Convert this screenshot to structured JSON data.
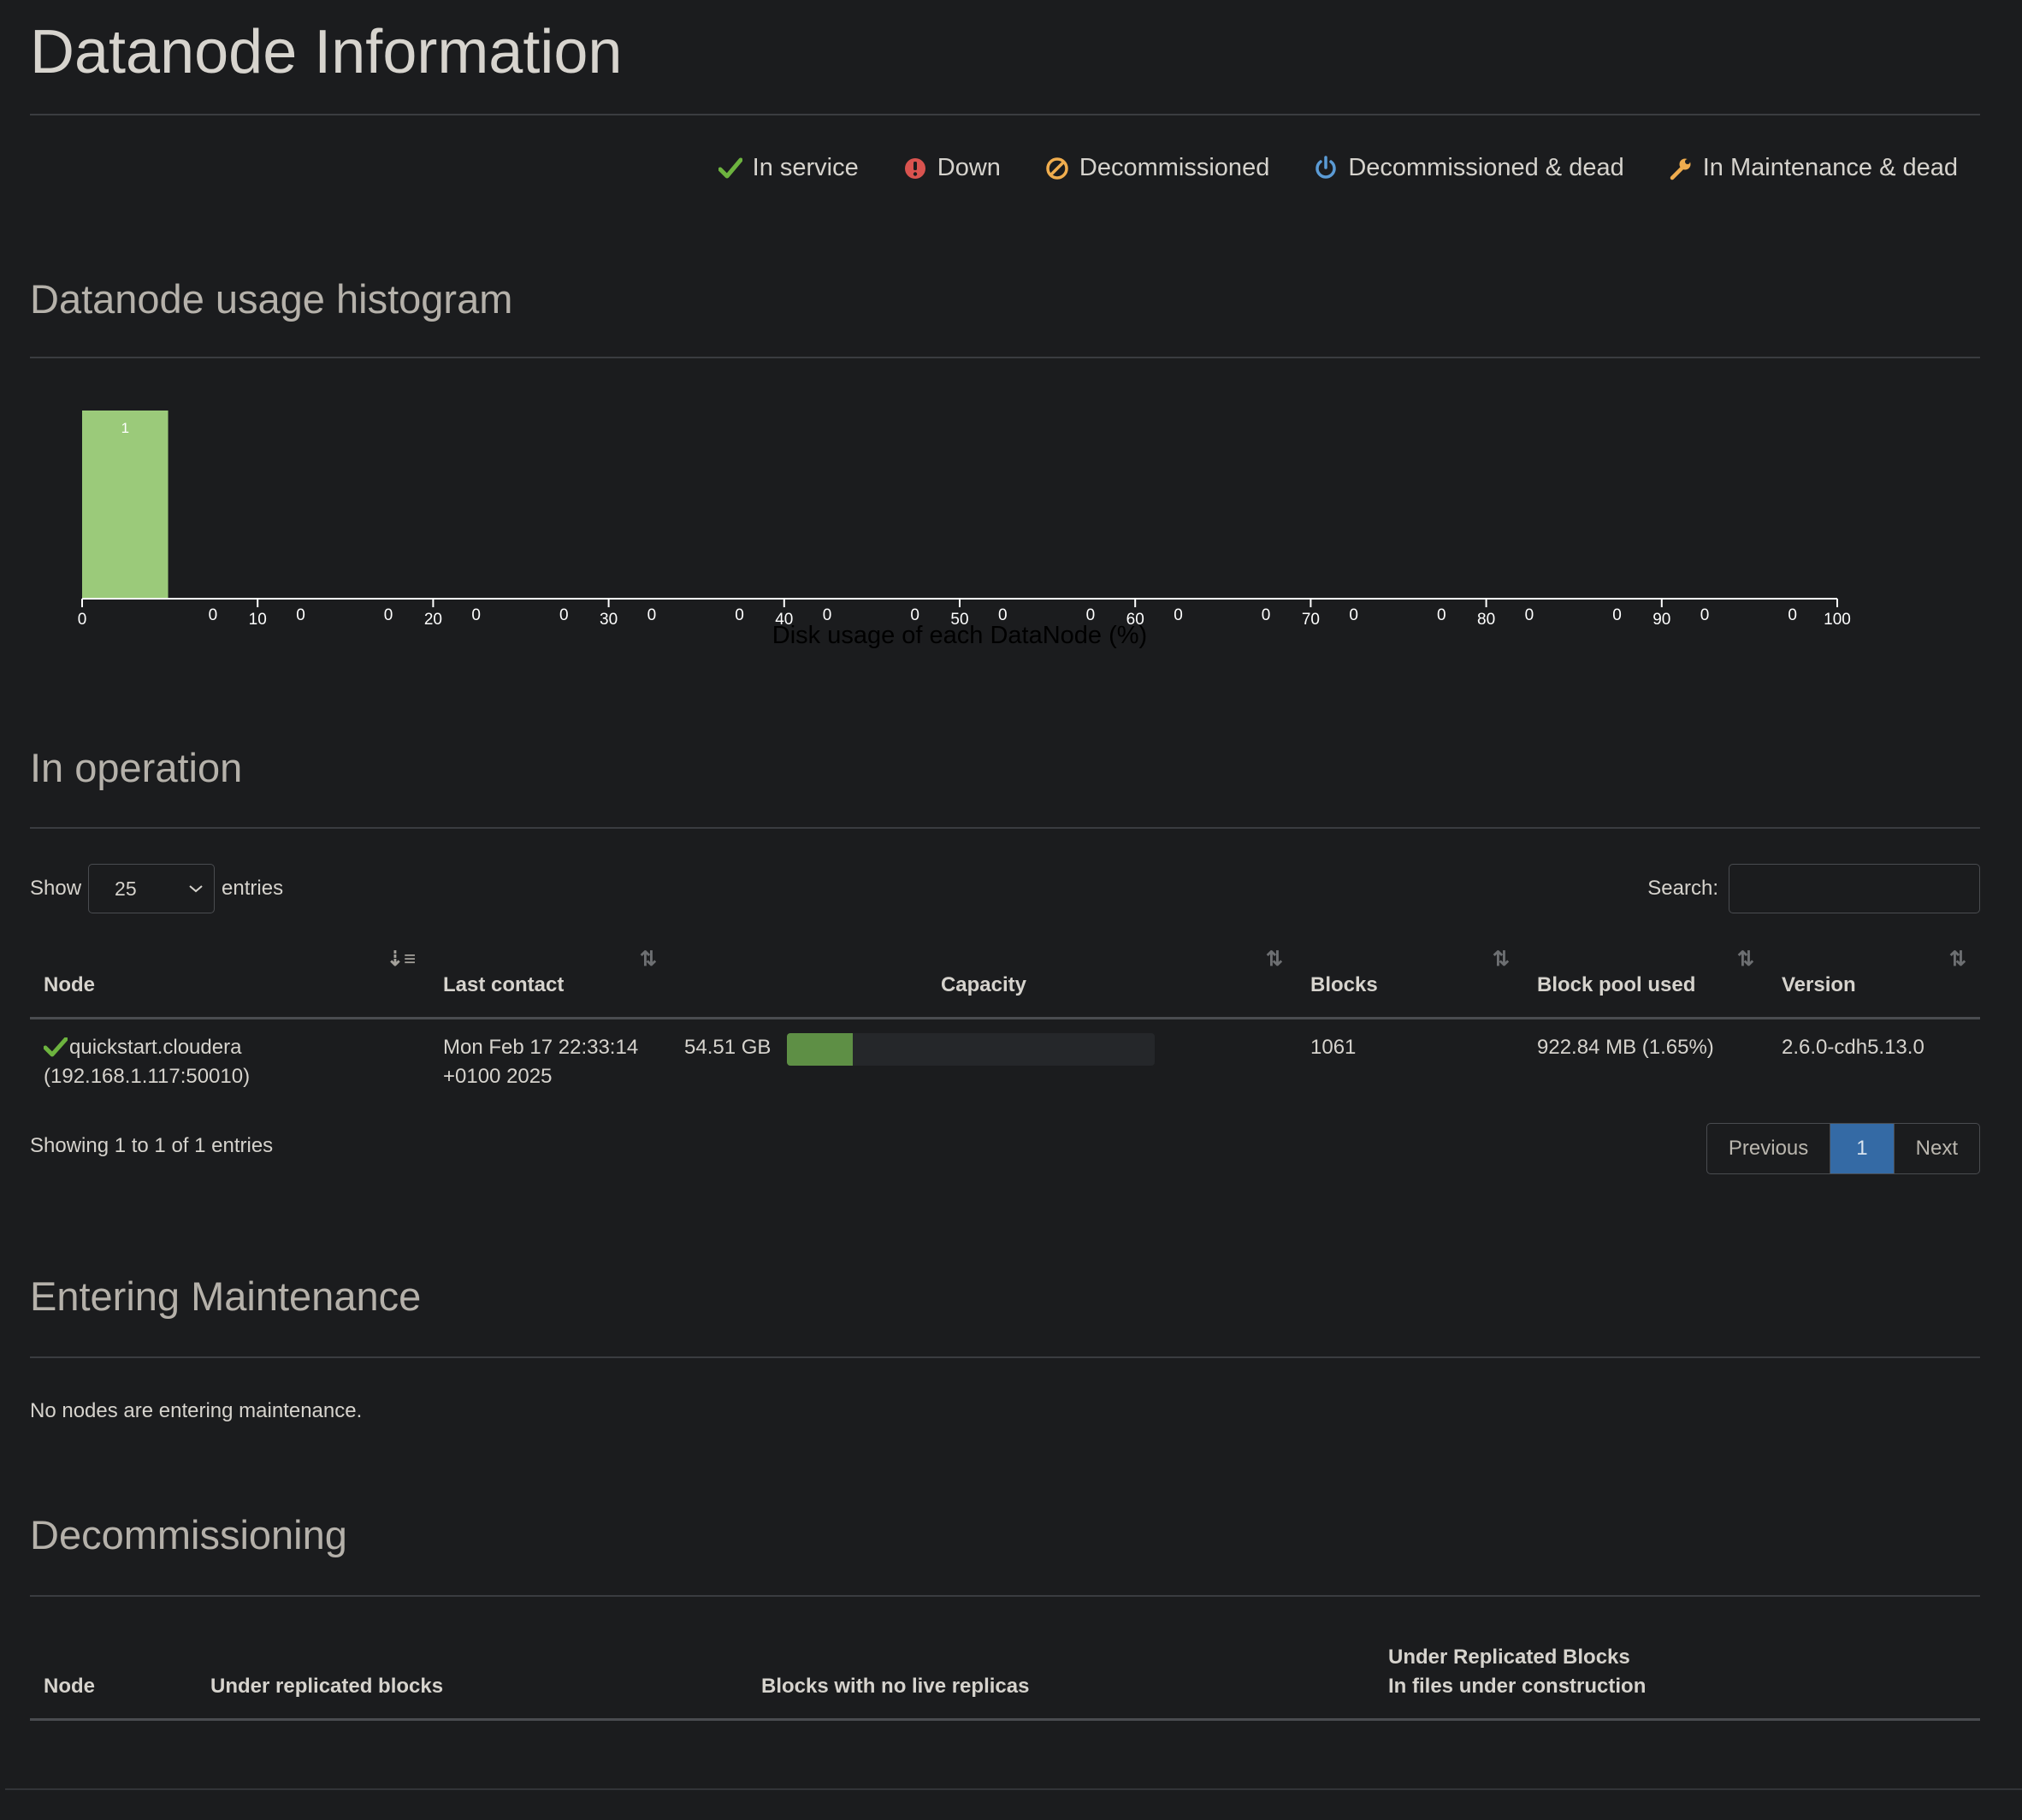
{
  "page": {
    "title": "Datanode Information"
  },
  "legend": [
    {
      "icon": "check-icon",
      "label": "In service",
      "color": "#6db33f"
    },
    {
      "icon": "exclamation-circle-icon",
      "label": "Down",
      "color": "#d9534f"
    },
    {
      "icon": "ban-icon",
      "label": "Decommissioned",
      "color": "#f0ad4e"
    },
    {
      "icon": "power-icon",
      "label": "Decommissioned & dead",
      "color": "#5b9bd5"
    },
    {
      "icon": "wrench-icon",
      "label": "In Maintenance & dead",
      "color": "#f0ad4e"
    }
  ],
  "histogram": {
    "title": "Datanode usage histogram",
    "chart_data": {
      "type": "bar",
      "xlabel": "Disk usage of each DataNode (%)",
      "xlim": [
        0,
        100
      ],
      "x_ticks": [
        0,
        10,
        20,
        30,
        40,
        50,
        60,
        70,
        80,
        90,
        100
      ],
      "bins": [
        {
          "range": [
            0,
            5
          ],
          "value": 1
        },
        {
          "range": [
            5,
            10
          ],
          "value": 0
        },
        {
          "range": [
            10,
            15
          ],
          "value": 0
        },
        {
          "range": [
            15,
            20
          ],
          "value": 0
        },
        {
          "range": [
            20,
            25
          ],
          "value": 0
        },
        {
          "range": [
            25,
            30
          ],
          "value": 0
        },
        {
          "range": [
            30,
            35
          ],
          "value": 0
        },
        {
          "range": [
            35,
            40
          ],
          "value": 0
        },
        {
          "range": [
            40,
            45
          ],
          "value": 0
        },
        {
          "range": [
            45,
            50
          ],
          "value": 0
        },
        {
          "range": [
            50,
            55
          ],
          "value": 0
        },
        {
          "range": [
            55,
            60
          ],
          "value": 0
        },
        {
          "range": [
            60,
            65
          ],
          "value": 0
        },
        {
          "range": [
            65,
            70
          ],
          "value": 0
        },
        {
          "range": [
            70,
            75
          ],
          "value": 0
        },
        {
          "range": [
            75,
            80
          ],
          "value": 0
        },
        {
          "range": [
            80,
            85
          ],
          "value": 0
        },
        {
          "range": [
            85,
            90
          ],
          "value": 0
        },
        {
          "range": [
            90,
            95
          ],
          "value": 0
        },
        {
          "range": [
            95,
            100
          ],
          "value": 0
        }
      ],
      "bar_color": "#9bca7a"
    }
  },
  "in_operation": {
    "title": "In operation",
    "show_label": "Show",
    "entries_label": "entries",
    "page_size": "25",
    "search_label": "Search:",
    "search_value": "",
    "columns": [
      "Node",
      "Last contact",
      "Capacity",
      "Blocks",
      "Block pool used",
      "Version"
    ],
    "rows": [
      {
        "node_name": "quickstart.cloudera",
        "node_addr": "(192.168.1.117:50010)",
        "last_contact_line1": "Mon Feb 17 22:33:14",
        "last_contact_line2": "+0100 2025",
        "capacity": "54.51 GB",
        "capacity_used_fraction": 0.18,
        "blocks": "1061",
        "block_pool_used": "922.84 MB (1.65%)",
        "version": "2.6.0-cdh5.13.0"
      }
    ],
    "showing": "Showing 1 to 1 of 1 entries",
    "pager": {
      "previous": "Previous",
      "current": "1",
      "next": "Next"
    }
  },
  "entering_maintenance": {
    "title": "Entering Maintenance",
    "note": "No nodes are entering maintenance."
  },
  "decommissioning": {
    "title": "Decommissioning",
    "columns": {
      "node": "Node",
      "under_replicated": "Under replicated blocks",
      "no_live_replicas": "Blocks with no live replicas",
      "under_construction_line1": "Under Replicated Blocks",
      "under_construction_line2": "In files under construction"
    }
  }
}
